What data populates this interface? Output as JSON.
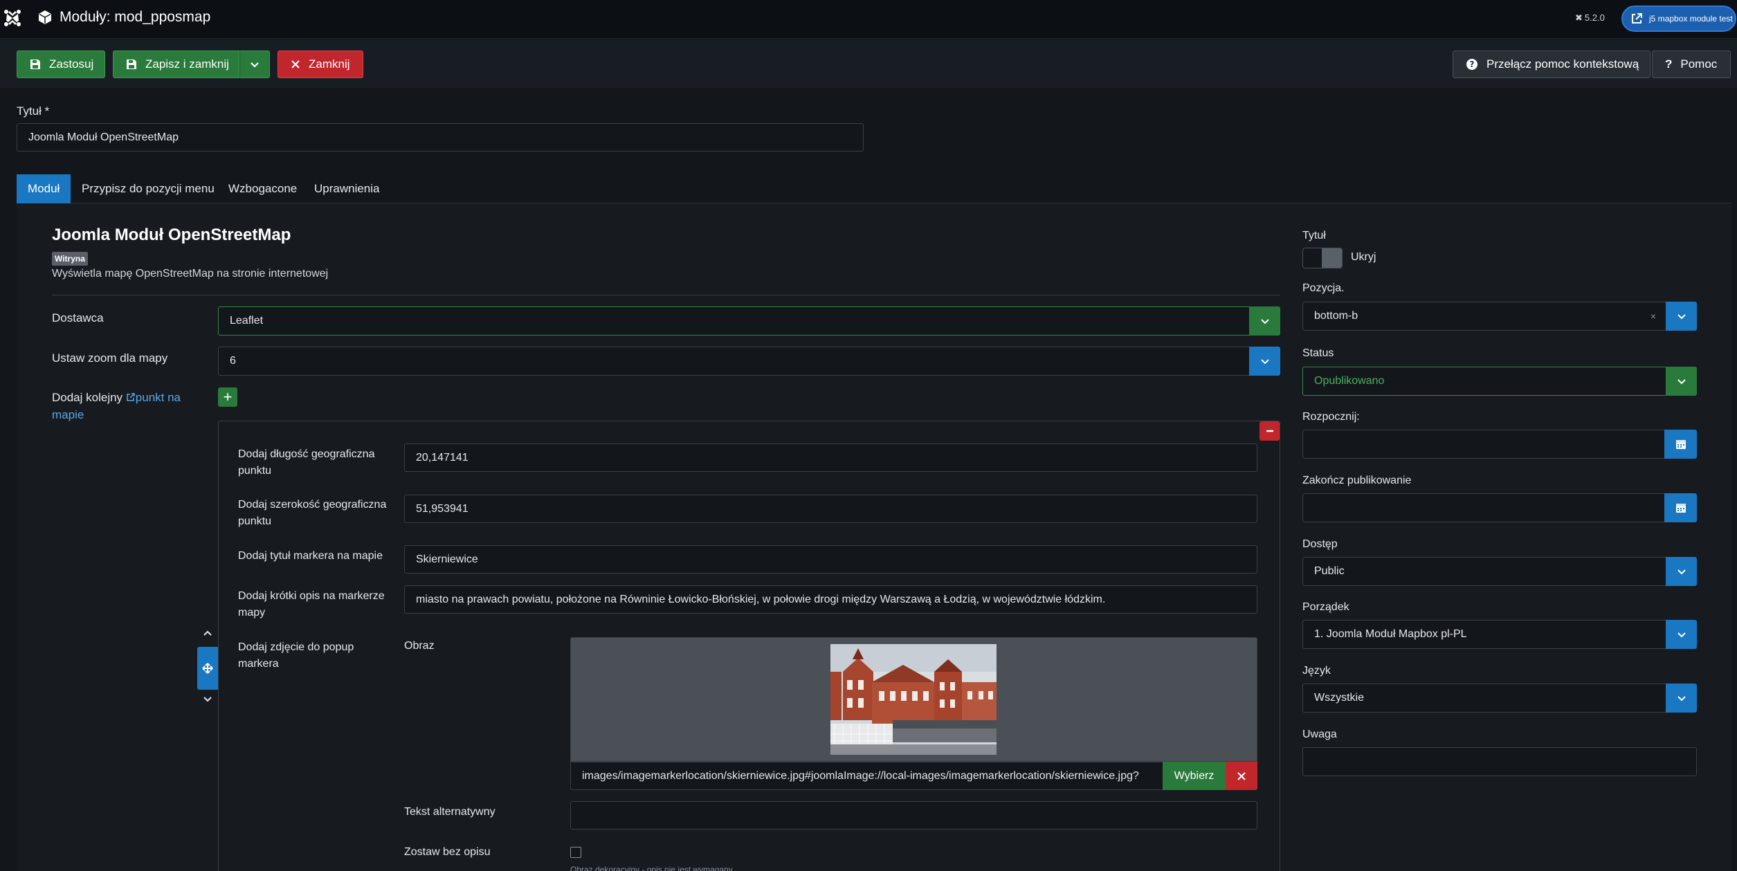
{
  "header": {
    "title": "Moduły: mod_pposmap",
    "version": "5.2.0",
    "site_link": "j5 mapbox module test"
  },
  "toolbar": {
    "apply": "Zastosuj",
    "save_close": "Zapisz i zamknij",
    "close": "Zamknij",
    "context_help": "Przełącz pomoc kontekstową",
    "help": "Pomoc"
  },
  "title_field": {
    "label": "Tytuł *",
    "value": "Joomla Moduł OpenStreetMap"
  },
  "tabs": [
    {
      "label": "Moduł",
      "active": true
    },
    {
      "label": "Przypisz do pozycji menu"
    },
    {
      "label": "Wzbogacone"
    },
    {
      "label": "Uprawnienia"
    }
  ],
  "module_info": {
    "heading": "Joomla Moduł OpenStreetMap",
    "badge": "Witryna",
    "description": "Wyświetla mapę OpenStreetMap na stronie internetowej"
  },
  "fields": {
    "provider": {
      "label": "Dostawca",
      "value": "Leaflet"
    },
    "zoom": {
      "label": "Ustaw zoom dla mapy",
      "value": "6"
    },
    "add_point": {
      "label_prefix": "Dodaj kolejny",
      "link": "punkt na mapie"
    }
  },
  "subform": {
    "longitude": {
      "label": "Dodaj długość geograficzna punktu",
      "value": "20,147141"
    },
    "latitude": {
      "label": "Dodaj szerokość geograficzna punktu",
      "value": "51,953941"
    },
    "marker_title": {
      "label": "Dodaj tytuł markera na mapie",
      "value": "Skierniewice"
    },
    "marker_desc": {
      "label": "Dodaj krótki opis na markerze mapy",
      "value": "miasto na prawach powiatu, położone na Równinie Łowicko-Błońskiej, w połowie drogi między Warszawą a Łodzią, w województwie łódzkim."
    },
    "popup_image": {
      "label": "Dodaj zdjęcie do popup markera"
    },
    "image": {
      "label": "Obraz",
      "path": "images/imagemarkerlocation/skierniewice.jpg#joomlaImage://local-images/imagemarkerlocation/skierniewice.jpg?",
      "select": "Wybierz"
    },
    "alt_text": {
      "label": "Tekst alternatywny",
      "value": ""
    },
    "no_desc": {
      "label": "Zostaw bez opisu",
      "hint": "Obraz dekoracyjny - opis nie jest wymagany"
    }
  },
  "sidebar": {
    "show_title": {
      "label": "Tytuł",
      "toggle_label": "Ukryj"
    },
    "position": {
      "label": "Pozycja.",
      "value": "bottom-b"
    },
    "status": {
      "label": "Status",
      "value": "Opublikowano"
    },
    "start": {
      "label": "Rozpocznij:",
      "value": ""
    },
    "finish": {
      "label": "Zakończ publikowanie",
      "value": ""
    },
    "access": {
      "label": "Dostęp",
      "value": "Public"
    },
    "ordering": {
      "label": "Porządek",
      "value": "1. Joomla Moduł Mapbox pl-PL"
    },
    "language": {
      "label": "Język",
      "value": "Wszystkie"
    },
    "note": {
      "label": "Uwaga",
      "value": ""
    }
  },
  "colors": {
    "accent": "#1a78c2",
    "success": "#2a7a3b",
    "danger": "#c1262d",
    "background": "#13171c"
  }
}
